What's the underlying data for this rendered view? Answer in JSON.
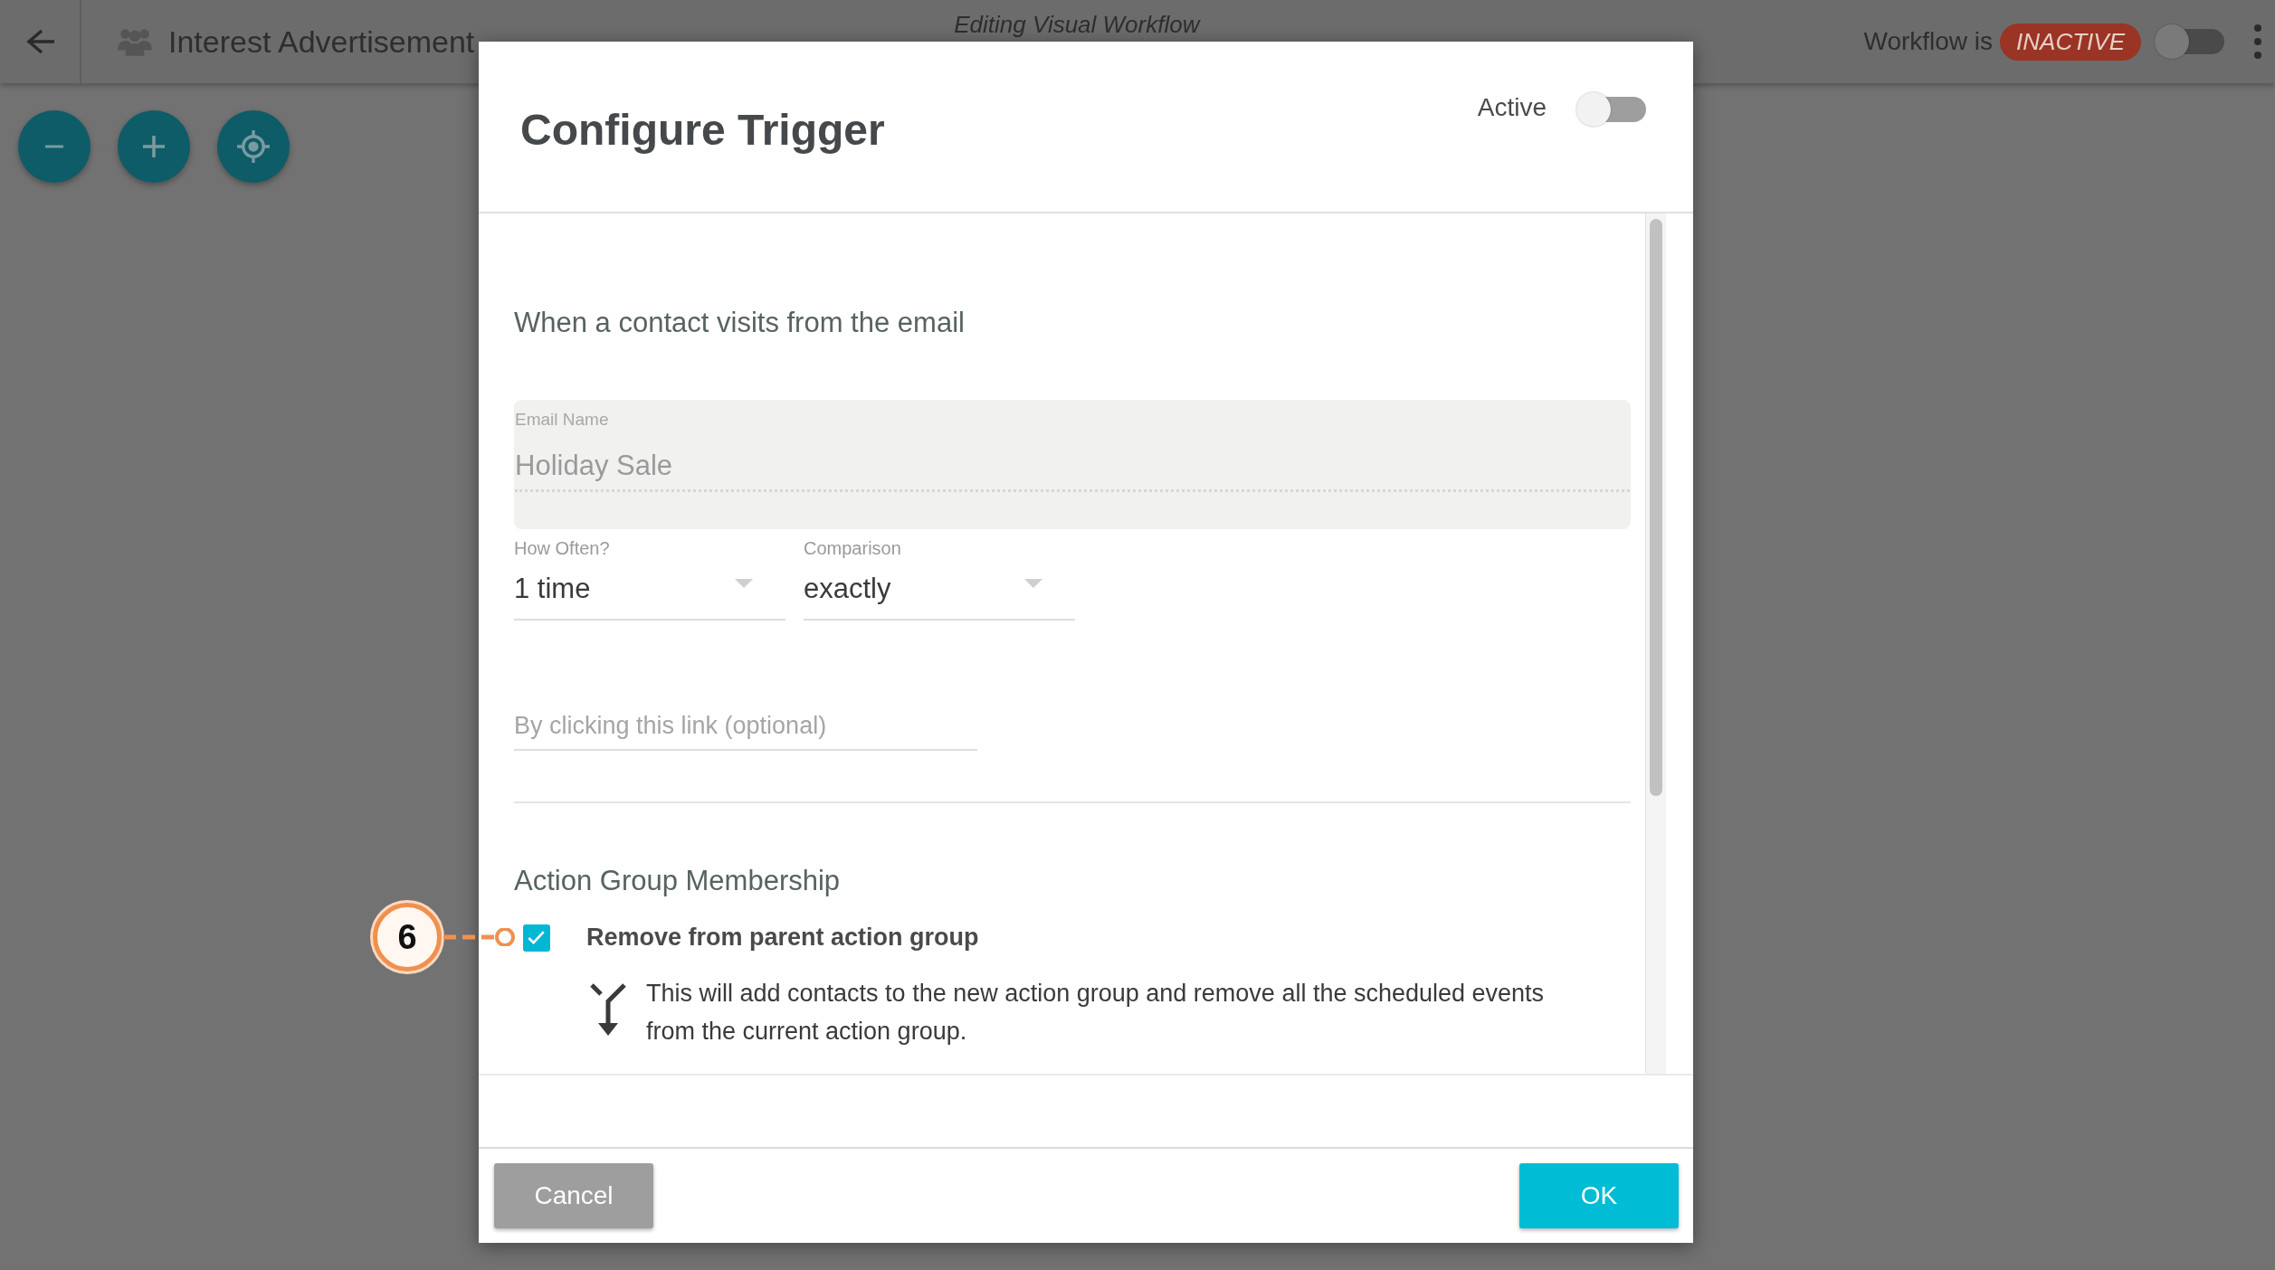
{
  "top_bar": {
    "title": "Interest Advertisement",
    "subtitle": "Editing Visual Workflow",
    "status_label": "Workflow is",
    "status_badge": "INACTIVE",
    "workflow_on": false
  },
  "canvas_controls": [
    {
      "kind": "zoom_out"
    },
    {
      "kind": "zoom_in"
    },
    {
      "kind": "center"
    }
  ],
  "dialog": {
    "title": "Configure Trigger",
    "active_label": "Active",
    "active_on": false,
    "section_title": "When a contact visits from the email",
    "email_field": {
      "label": "Email Name",
      "value": "Holiday Sale",
      "disabled": true
    },
    "selects": [
      {
        "label": "How Often?",
        "value": "1 time"
      },
      {
        "label": "Comparison",
        "value": "exactly"
      }
    ],
    "link_field": {
      "placeholder": "By clicking this link (optional)"
    },
    "group_title": "Action Group Membership",
    "checkbox": {
      "label": "Remove from parent action group",
      "checked": true
    },
    "note": "This will add contacts to the new action group and remove all the scheduled events from the current action group.",
    "buttons": [
      {
        "label": "Cancel",
        "kind": "secondary"
      },
      {
        "label": "OK",
        "kind": "primary"
      }
    ]
  },
  "callout": {
    "number": "6"
  }
}
